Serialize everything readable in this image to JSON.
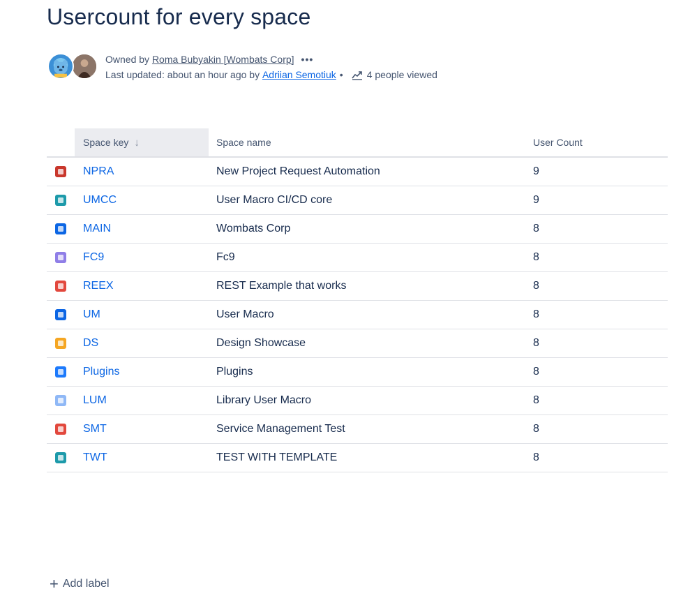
{
  "page": {
    "title": "Usercount for every space"
  },
  "byline": {
    "owned_prefix": "Owned by",
    "owner": "Roma Bubyakin [Wombats Corp]",
    "more": "•••",
    "updated_prefix": "Last updated: about an hour ago by",
    "updated_by": "Adriian Semotiuk",
    "separator": "•",
    "views": "4 people viewed"
  },
  "table": {
    "headers": {
      "key": "Space key",
      "name": "Space name",
      "count": "User Count"
    },
    "sort_indicator": "↓",
    "rows": [
      {
        "icon": "npra-space-icon",
        "color": "#c9372c",
        "key": "NPRA",
        "name": "New Project Request Automation",
        "count": "9"
      },
      {
        "icon": "umcc-space-icon",
        "color": "#1d9aaa",
        "key": "UMCC",
        "name": "User Macro CI/CD core",
        "count": "9"
      },
      {
        "icon": "wombat-space-icon",
        "color": "#0c66e4",
        "key": "MAIN",
        "name": "Wombats Corp",
        "count": "8"
      },
      {
        "icon": "fc9-space-icon",
        "color": "#8f7ee7",
        "key": "FC9",
        "name": "Fc9",
        "count": "8"
      },
      {
        "icon": "reex-space-icon",
        "color": "#e2483d",
        "key": "REEX",
        "name": "REST Example that works",
        "count": "8"
      },
      {
        "icon": "um-space-icon",
        "color": "#0c66e4",
        "key": "UM",
        "name": "User Macro",
        "count": "8"
      },
      {
        "icon": "ds-space-icon",
        "color": "#f5a623",
        "key": "DS",
        "name": "Design Showcase",
        "count": "8"
      },
      {
        "icon": "plugins-space-icon",
        "color": "#1d7afc",
        "key": "Plugins",
        "name": "Plugins",
        "count": "8"
      },
      {
        "icon": "lum-space-icon",
        "color": "#8fb8f6",
        "key": "LUM",
        "name": "Library User Macro",
        "count": "8"
      },
      {
        "icon": "smt-space-icon",
        "color": "#e2483d",
        "key": "SMT",
        "name": "Service Management Test",
        "count": "8"
      },
      {
        "icon": "twt-space-icon",
        "color": "#1d9aaa",
        "key": "TWT",
        "name": "TEST WITH TEMPLATE",
        "count": "8"
      }
    ]
  },
  "footer": {
    "add_label_icon": "+",
    "add_label": "Add label"
  }
}
